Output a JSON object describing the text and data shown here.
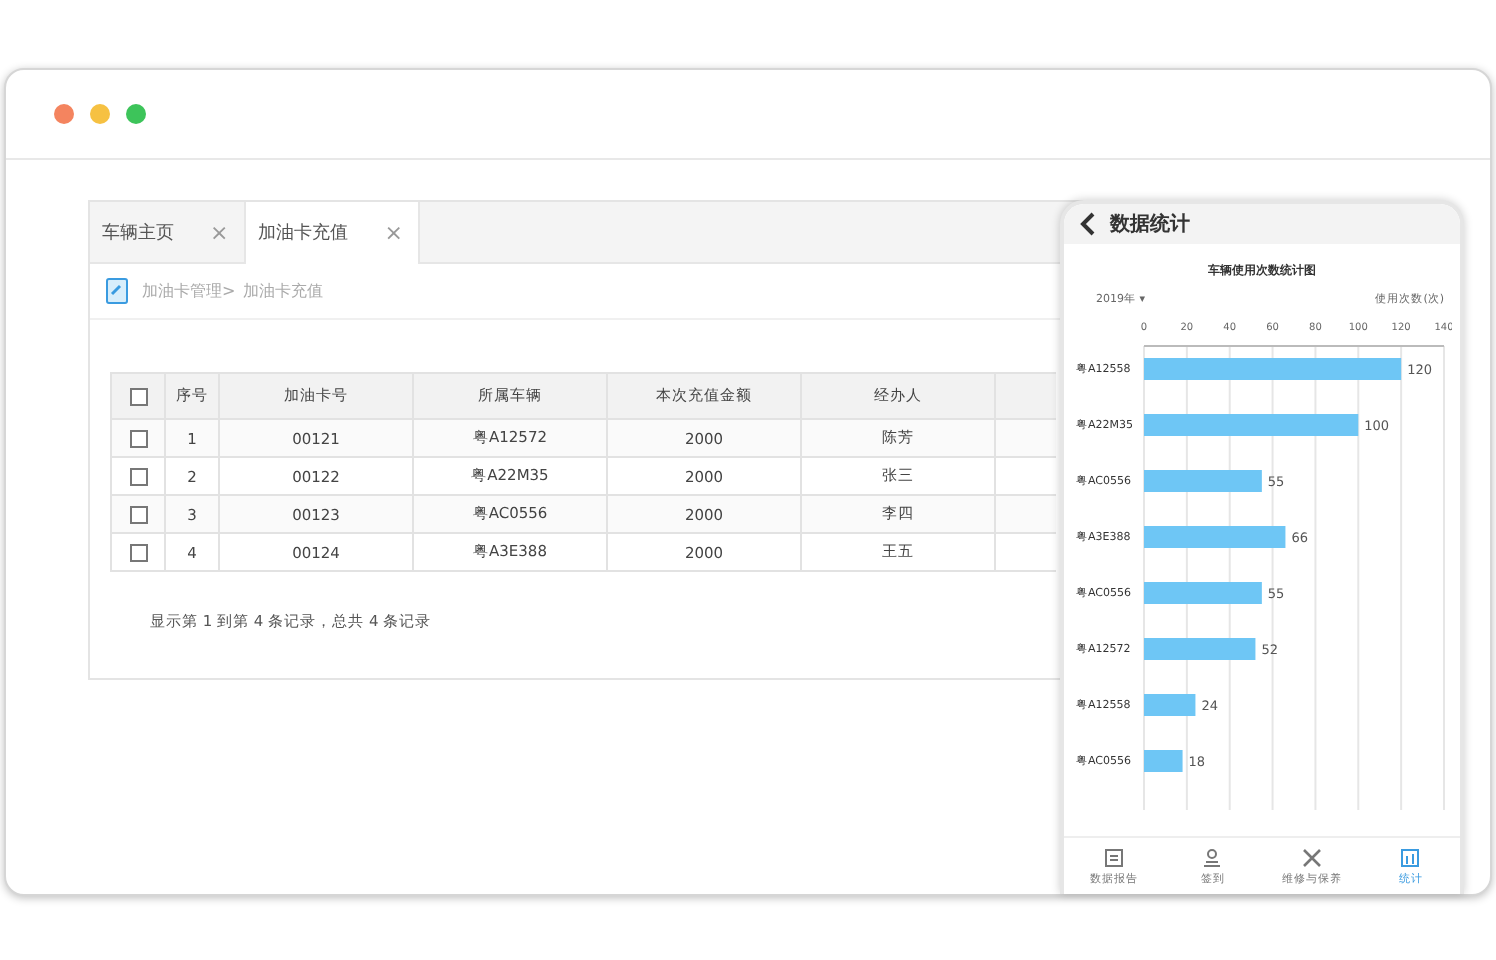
{
  "tabs": [
    {
      "label": "车辆主页",
      "selected": false,
      "close": "×"
    },
    {
      "label": "加油卡充值",
      "selected": true,
      "close": "×"
    }
  ],
  "breadcrumb": [
    "加油卡管理>",
    "加油卡充值"
  ],
  "table": {
    "header_checked": false,
    "columns": [
      "序号",
      "加油卡号",
      "所属车辆",
      "本次充值金额",
      "经办人"
    ],
    "rows": [
      {
        "checked": false,
        "cells": [
          "1",
          "00121",
          "粤A12572",
          "2000",
          "陈芳"
        ]
      },
      {
        "checked": false,
        "cells": [
          "2",
          "00122",
          "粤A22M35",
          "2000",
          "张三"
        ]
      },
      {
        "checked": false,
        "cells": [
          "3",
          "00123",
          "粤AC0556",
          "2000",
          "李四"
        ]
      },
      {
        "checked": false,
        "cells": [
          "4",
          "00124",
          "粤A3E388",
          "2000",
          "王五"
        ]
      }
    ]
  },
  "footer": "显示第 1 到第 4 条记录，总共 4 条记录",
  "phone": {
    "title": "数据统计",
    "year": "2019年",
    "year_caret": "▾",
    "chart_data": {
      "type": "bar",
      "orientation": "horizontal",
      "title": "车辆使用次数统计图",
      "xlabel": "使用次数(次)",
      "data_labels": true,
      "grid": true,
      "xlim": [
        0,
        140
      ],
      "xticks": [
        0,
        20,
        40,
        60,
        80,
        100,
        120,
        140
      ],
      "categories": [
        "粤A12558",
        "粤A22M35",
        "粤AC0556",
        "粤A3E388",
        "粤AC0556",
        "粤A12572",
        "粤A12558",
        "粤AC0556"
      ],
      "series": [
        {
          "color": "#6ec6f5",
          "values": [
            120,
            100,
            55,
            66,
            55,
            52,
            24,
            18
          ]
        }
      ]
    },
    "nav": [
      {
        "label": "数据报告",
        "selected": false
      },
      {
        "label": "签到",
        "selected": false
      },
      {
        "label": "维修与保养",
        "selected": false
      },
      {
        "label": "统计",
        "selected": true
      }
    ]
  }
}
